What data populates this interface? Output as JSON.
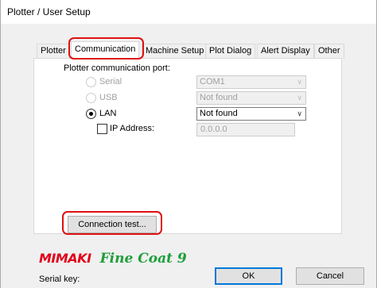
{
  "window": {
    "title": "Plotter / User Setup"
  },
  "tabs": [
    {
      "label": "Plotter"
    },
    {
      "label": "Communication"
    },
    {
      "label": "Machine Setup"
    },
    {
      "label": "Plot Dialog"
    },
    {
      "label": "Alert Display"
    },
    {
      "label": "Other"
    }
  ],
  "active_tab": "Communication",
  "communication": {
    "port_label": "Plotter communication port:",
    "serial": {
      "label": "Serial",
      "value": "COM1",
      "selected": false,
      "enabled": false
    },
    "usb": {
      "label": "USB",
      "value": "Not found",
      "selected": false,
      "enabled": false
    },
    "lan": {
      "label": "LAN",
      "value": "Not found",
      "selected": true,
      "enabled": true
    },
    "ip": {
      "label": "IP Address:",
      "checked": false,
      "value": "0.0.0.0"
    },
    "connection_test_label": "Connection test..."
  },
  "footer": {
    "logo_brand": "MIMAKI",
    "logo_product": "Fine Coat 9",
    "serial_key_label": "Serial key:",
    "ok_label": "OK",
    "cancel_label": "Cancel"
  },
  "colors": {
    "highlight": "#e01010",
    "brand_red": "#e0001a",
    "brand_green": "#1e9e3a",
    "focus_blue": "#0078d7"
  }
}
